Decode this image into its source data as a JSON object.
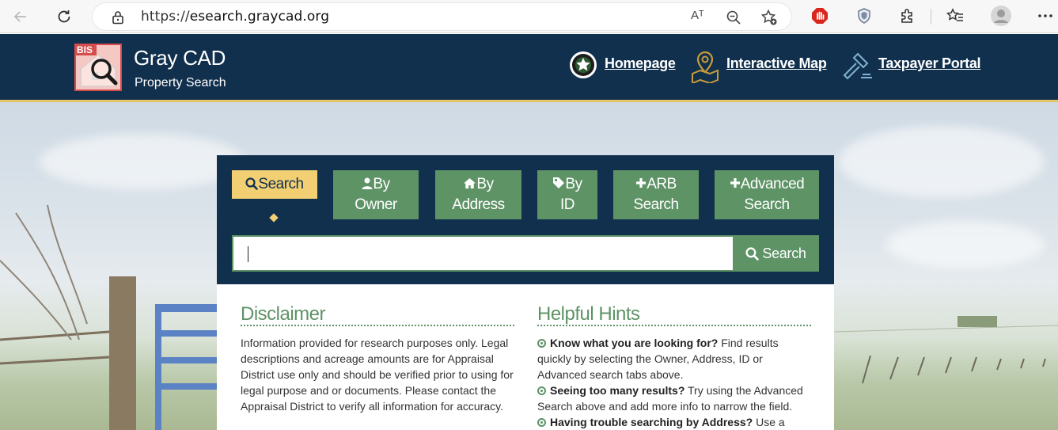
{
  "browser": {
    "url_prefix": "https://",
    "url_host": "esearch.graycad.org",
    "read_aloud_label": "Aᵀ"
  },
  "header": {
    "logo_text": "BIS",
    "title": "Gray CAD",
    "subtitle": "Property Search",
    "links": [
      {
        "label": "Homepage",
        "icon": "star-seal-icon"
      },
      {
        "label": "Interactive Map",
        "icon": "map-pin-icon"
      },
      {
        "label": "Taxpayer Portal",
        "icon": "gavel-icon"
      }
    ]
  },
  "search": {
    "tabs": [
      {
        "label": "Search",
        "icon": "search-icon",
        "active": true
      },
      {
        "label_top": "By",
        "label_bottom": "Owner",
        "icon": "user-icon"
      },
      {
        "label_top": "By",
        "label_bottom": "Address",
        "icon": "home-icon"
      },
      {
        "label_top": "By",
        "label_bottom": "ID",
        "icon": "tag-icon"
      },
      {
        "label_top": "ARB",
        "label_bottom": "Search",
        "icon": "plus-icon"
      },
      {
        "label_top": "Advanced",
        "label_bottom": "Search",
        "icon": "plus-icon"
      }
    ],
    "input_value": "",
    "button_label": "Search"
  },
  "disclaimer": {
    "title": "Disclaimer",
    "text": "Information provided for research purposes only. Legal descriptions and acreage amounts are for Appraisal District use only and should be verified prior to using for legal purpose and or documents. Please contact the Appraisal District to verify all information for accuracy."
  },
  "hints": {
    "title": "Helpful Hints",
    "items": [
      {
        "bold": "Know what you are looking for?",
        "text": " Find results quickly by selecting the Owner, Address, ID or Advanced search tabs above."
      },
      {
        "bold": "Seeing too many results?",
        "text": " Try using the Advanced Search above and add more info to narrow the field."
      },
      {
        "bold": "Having trouble searching by Address?",
        "text": " Use a"
      }
    ]
  },
  "colors": {
    "navy": "#11304d",
    "green": "#5e9366",
    "gold": "#f2cf73"
  }
}
